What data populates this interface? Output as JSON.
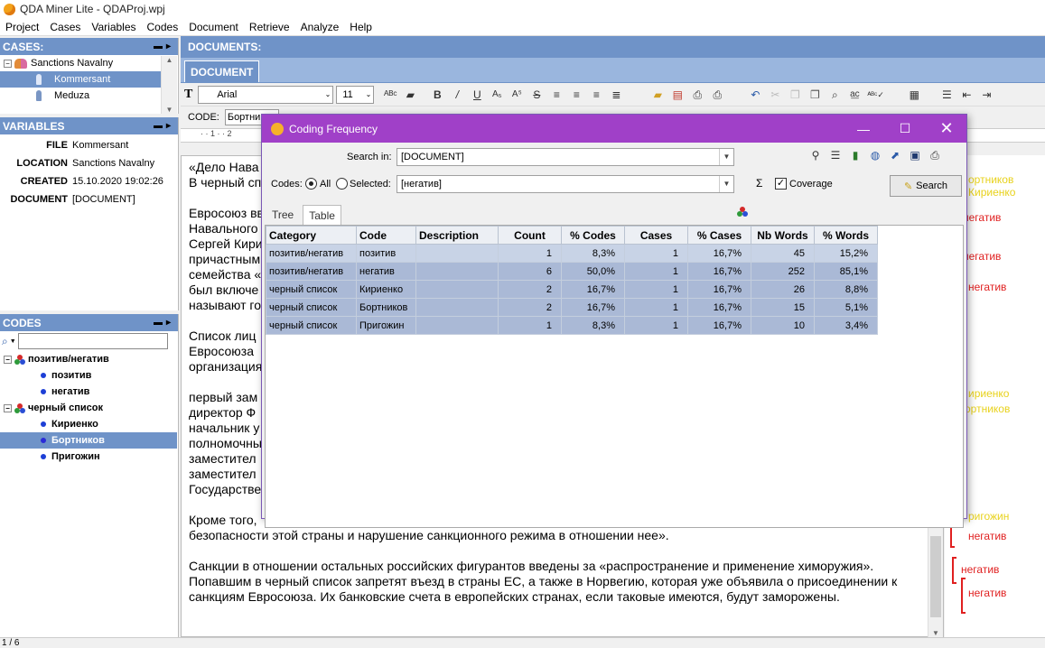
{
  "window": {
    "title": "QDA Miner Lite - QDAProj.wpj"
  },
  "menu": [
    "Project",
    "Cases",
    "Variables",
    "Codes",
    "Document",
    "Retrieve",
    "Analyze",
    "Help"
  ],
  "cases": {
    "header": "CASES:",
    "root": "Sanctions Navalny",
    "items": [
      "Kommersant",
      "Meduza"
    ]
  },
  "variables": {
    "header": "VARIABLES",
    "rows": [
      {
        "name": "FILE",
        "value": "Kommersant"
      },
      {
        "name": "LOCATION",
        "value": "Sanctions Navalny"
      },
      {
        "name": "CREATED",
        "value": "15.10.2020 19:02:26"
      },
      {
        "name": "DOCUMENT",
        "value": "[DOCUMENT]"
      }
    ]
  },
  "codes": {
    "header": "CODES",
    "groups": [
      {
        "name": "позитив/негатив",
        "items": [
          "позитив",
          "негатив"
        ]
      },
      {
        "name": "черный список",
        "items": [
          "Кириенко",
          "Бортников",
          "Пригожин"
        ]
      }
    ],
    "selected": "Бортников"
  },
  "documents": {
    "header": "DOCUMENTS:",
    "tab": "DOCUMENT",
    "font": "Arial",
    "size": "11",
    "code_label": "CODE:",
    "code_value": "Бортни"
  },
  "doc_text": {
    "left_fragments": [
      "«Дело Нава",
      "В черный сп",
      "Евросоюз вв",
      "Навального",
      "Сергей Кири",
      "причастным",
      "семейства «",
      "был включе",
      "называют го",
      "Список лиц",
      "Евросоюза",
      "организация",
      "первый зам",
      "директор Ф",
      "начальник у",
      "полномочны",
      "заместител",
      "заместител",
      "Государстве",
      "Кроме того,"
    ],
    "p_cut": "безопасности этой страны и нарушение санкционного режима в отношении нее».",
    "p1": "Санкции в отношении остальных российских фигурантов введены за «распространение и применение химоружия». Попавшим в черный список запретят въезд в страны ЕС, а также в Норвегию, которая уже объявила о присоединении к санкциям Евросоюза. Их банковские счета в европейских странах, если таковые имеются, будут заморожены."
  },
  "margin_labels": [
    {
      "text": "ортников",
      "color": "#e8d21c"
    },
    {
      "text": "Кириенко",
      "color": "#e8d21c"
    },
    {
      "text": "негатив",
      "color": "#e02020"
    },
    {
      "text": "негатив",
      "color": "#e02020"
    },
    {
      "text": "негатив",
      "color": "#e02020"
    },
    {
      "text": "ириенко",
      "color": "#e8d21c"
    },
    {
      "text": "ортников",
      "color": "#e8d21c"
    },
    {
      "text": "ригожин",
      "color": "#e8d21c"
    },
    {
      "text": "негатив",
      "color": "#e02020"
    },
    {
      "text": "негатив",
      "color": "#e02020"
    },
    {
      "text": "негатив",
      "color": "#e02020"
    }
  ],
  "dialog": {
    "title": "Coding Frequency",
    "search_in_label": "Search in:",
    "search_in_value": "[DOCUMENT]",
    "codes_label": "Codes:",
    "radio_all": "All",
    "radio_selected": "Selected:",
    "selected_value": "[негатив]",
    "coverage_label": "Coverage",
    "search_button": "Search",
    "tabs": [
      "Tree",
      "Table"
    ],
    "active_tab": "Table",
    "columns": [
      "Category",
      "Code",
      "Description",
      "Count",
      "% Codes",
      "Cases",
      "% Cases",
      "Nb Words",
      "% Words"
    ],
    "rows": [
      [
        "позитив/негатив",
        "позитив",
        "",
        "1",
        "8,3%",
        "1",
        "16,7%",
        "45",
        "15,2%"
      ],
      [
        "позитив/негатив",
        "негатив",
        "",
        "6",
        "50,0%",
        "1",
        "16,7%",
        "252",
        "85,1%"
      ],
      [
        "черный список",
        "Кириенко",
        "",
        "2",
        "16,7%",
        "1",
        "16,7%",
        "26",
        "8,8%"
      ],
      [
        "черный список",
        "Бортников",
        "",
        "2",
        "16,7%",
        "1",
        "16,7%",
        "15",
        "5,1%"
      ],
      [
        "черный список",
        "Пригожин",
        "",
        "1",
        "8,3%",
        "1",
        "16,7%",
        "10",
        "3,4%"
      ]
    ]
  },
  "status": {
    "page": "1 / 6"
  }
}
